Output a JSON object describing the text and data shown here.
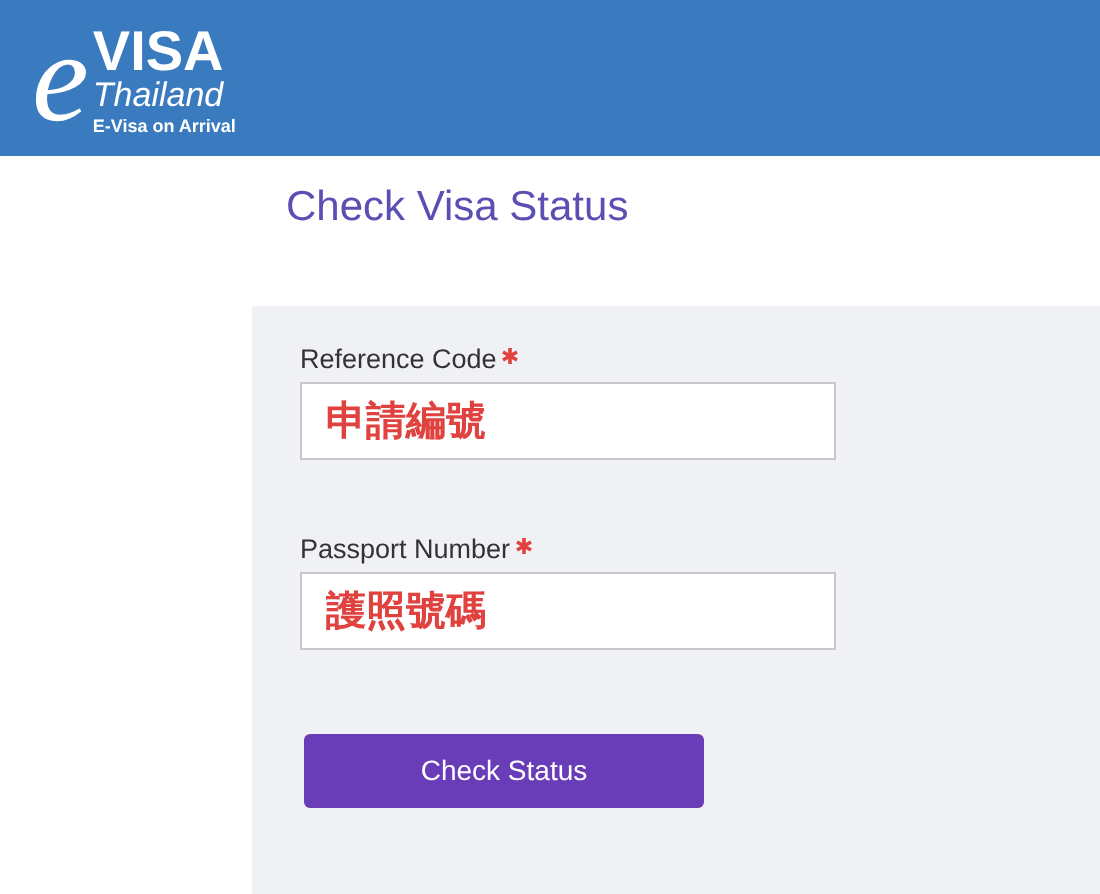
{
  "header": {
    "logo": {
      "letter": "e",
      "word": "VISA",
      "country": "Thailand",
      "tagline": "E-Visa on Arrival"
    }
  },
  "title": "Check Visa Status",
  "form": {
    "fields": [
      {
        "label": "Reference Code",
        "required": true,
        "value": "申請編號"
      },
      {
        "label": "Passport Number",
        "required": true,
        "value": "護照號碼"
      }
    ],
    "button": "Check Status"
  }
}
